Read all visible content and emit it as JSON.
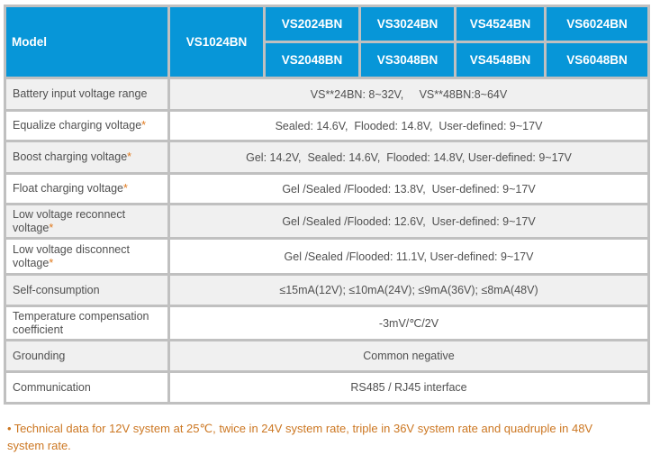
{
  "table": {
    "header": {
      "model_label": "Model",
      "single_model": "VS1024BN",
      "models_24": [
        "VS2024BN",
        "VS3024BN",
        "VS4524BN",
        "VS6024BN"
      ],
      "models_48": [
        "VS2048BN",
        "VS3048BN",
        "VS4548BN",
        "VS6048BN"
      ]
    },
    "rows": [
      {
        "label": "Battery input voltage range",
        "starred": false,
        "value": "VS**24BN: 8~32V,     VS**48BN:8~64V"
      },
      {
        "label": "Equalize charging voltage",
        "starred": true,
        "value": "Sealed: 14.6V,  Flooded: 14.8V,  User-defined: 9~17V"
      },
      {
        "label": "Boost charging voltage",
        "starred": true,
        "value": "Gel: 14.2V,  Sealed: 14.6V,  Flooded: 14.8V, User-defined: 9~17V"
      },
      {
        "label": "Float charging voltage",
        "starred": true,
        "value": "Gel /Sealed /Flooded: 13.8V,  User-defined: 9~17V"
      },
      {
        "label": "Low voltage reconnect voltage",
        "starred": true,
        "value": "Gel /Sealed /Flooded: 12.6V,  User-defined: 9~17V"
      },
      {
        "label": "Low voltage disconnect voltage",
        "starred": true,
        "value": "Gel /Sealed /Flooded: 11.1V, User-defined: 9~17V"
      },
      {
        "label": "Self-consumption",
        "starred": false,
        "value": "≤15mA(12V); ≤10mA(24V); ≤9mA(36V); ≤8mA(48V)"
      },
      {
        "label": "Temperature compensation coefficient",
        "starred": false,
        "value": "-3mV/℃/2V"
      },
      {
        "label": "Grounding",
        "starred": false,
        "value": "Common negative"
      },
      {
        "label": "Communication",
        "starred": false,
        "value": "RS485 / RJ45 interface"
      }
    ],
    "star_symbol": "*"
  },
  "footnote": {
    "bullet": "•",
    "text": "Technical data for 12V system at 25℃, twice in 24V system rate, triple in 36V system rate and quadruple in 48V system rate."
  },
  "colors": {
    "header_bg": "#0796d8",
    "accent_note": "#cc7722",
    "border": "#c0c0c0"
  }
}
